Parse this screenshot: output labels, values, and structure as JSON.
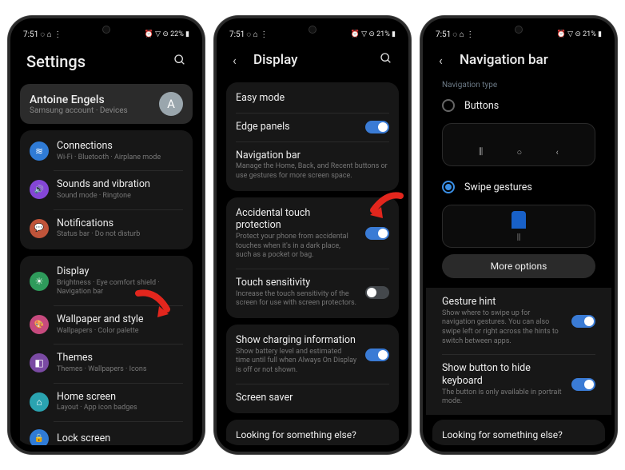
{
  "status": {
    "time": "7:51",
    "icons_left": "◌ ⌂ ⋮",
    "right_s1": "⏰ ▽ ⊝ 22% ▮",
    "right_s2": "⏰ ▽ ⊝ 21% ▮",
    "right_s3": "⏰ ▽ ⊝ 21% ▮"
  },
  "screen1": {
    "title": "Settings",
    "account": {
      "name": "Antoine Engels",
      "sub": "Samsung account  ·  Devices",
      "initial": "A"
    },
    "items": [
      {
        "title": "Connections",
        "sub": "Wi-Fi · Bluetooth · Airplane mode",
        "color": "#2f7bd6",
        "glyph": "≋"
      },
      {
        "title": "Sounds and vibration",
        "sub": "Sound mode · Ringtone",
        "color": "#8446d6",
        "glyph": "🔊"
      },
      {
        "title": "Notifications",
        "sub": "Status bar · Do not disturb",
        "color": "#c0543a",
        "glyph": "💬"
      },
      {
        "title": "Display",
        "sub": "Brightness · Eye comfort shield · Navigation bar",
        "color": "#2e9b5b",
        "glyph": "☀"
      },
      {
        "title": "Wallpaper and style",
        "sub": "Wallpapers · Color palette",
        "color": "#c74a7e",
        "glyph": "🎨"
      },
      {
        "title": "Themes",
        "sub": "Themes · Wallpapers · Icons",
        "color": "#7a4aa3",
        "glyph": "◧"
      },
      {
        "title": "Home screen",
        "sub": "Layout · App icon badges",
        "color": "#2aa3b0",
        "glyph": "⌂"
      },
      {
        "title": "Lock screen",
        "sub": "",
        "color": "#2f7bd6",
        "glyph": "🔒"
      }
    ]
  },
  "screen2": {
    "title": "Display",
    "items": [
      {
        "title": "Easy mode",
        "sub": ""
      },
      {
        "title": "Edge panels",
        "sub": "",
        "toggle": "on"
      },
      {
        "title": "Navigation bar",
        "sub": "Manage the Home, Back, and Recent buttons or use gestures for more screen space."
      },
      {
        "title": "Accidental touch protection",
        "sub": "Protect your phone from accidental touches when it's in a dark place, such as a pocket or bag.",
        "toggle": "on"
      },
      {
        "title": "Touch sensitivity",
        "sub": "Increase the touch sensitivity of the screen for use with screen protectors.",
        "toggle": "off"
      },
      {
        "title": "Show charging information",
        "sub": "Show battery level and estimated time until full when Always On Display is off or not shown.",
        "toggle": "on"
      },
      {
        "title": "Screen saver",
        "sub": ""
      }
    ],
    "footer": "Looking for something else?"
  },
  "screen3": {
    "title": "Navigation bar",
    "nav_type_label": "Navigation type",
    "option_buttons": "Buttons",
    "option_gestures": "Swipe gestures",
    "more_options": "More options",
    "symbols": {
      "recents": "⫼",
      "home": "○",
      "back": "‹"
    },
    "items": [
      {
        "title": "Gesture hint",
        "sub": "Show where to swipe up for navigation gestures. You can also swipe left or right across the hints to switch between apps.",
        "toggle": "on"
      },
      {
        "title": "Show button to hide keyboard",
        "sub": "The button is only available in portrait mode.",
        "toggle": "on"
      }
    ],
    "footer": "Looking for something else?"
  }
}
